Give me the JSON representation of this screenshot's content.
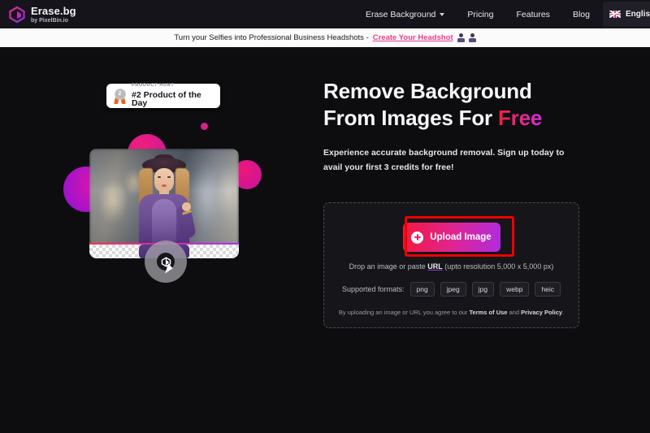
{
  "brand": {
    "name": "Erase.bg",
    "tagline": "by PixelBin.io",
    "logo_icon": "cube-logo-icon"
  },
  "nav": {
    "items": [
      {
        "label": "Erase Background",
        "has_dropdown": true
      },
      {
        "label": "Pricing",
        "has_dropdown": false
      },
      {
        "label": "Features",
        "has_dropdown": false
      },
      {
        "label": "Blog",
        "has_dropdown": false
      }
    ],
    "language": {
      "label": "English",
      "flag_icon": "uk-flag-icon"
    }
  },
  "promo": {
    "text": "Turn your Selfies into Professional Business Headshots -",
    "link": "Create Your Headshot"
  },
  "badge": {
    "kicker": "PRODUCT HUNT",
    "title": "#2 Product of the Day",
    "medal_number": "2",
    "medal_icon": "medal-icon"
  },
  "hero": {
    "title_line1": "Remove Background",
    "title_line2_prefix": "From Images For ",
    "title_highlight": "Free",
    "subtitle": "Experience accurate background removal. Sign up today to avail your first 3 credits for free!"
  },
  "upload": {
    "button_label": "Upload Image",
    "button_icon": "plus-circle-icon",
    "drop_prefix": "Drop an image or paste ",
    "drop_link": "URL",
    "drop_suffix": " (upto resolution 5,000 x 5,000 px)",
    "formats_label": "Supported formats:",
    "formats": [
      "png",
      "jpeg",
      "jpg",
      "webp",
      "heic"
    ],
    "legal_prefix": "By uploading an image or URL you agree to our ",
    "legal_terms": "Terms of Use",
    "legal_and": " and ",
    "legal_privacy": "Privacy Policy",
    "legal_end": "."
  },
  "colors": {
    "page_bg": "#0d0d0f",
    "nav_bg": "#15141a",
    "promo_bg": "#fbfbfb",
    "promo_link": "#e83e8c",
    "accent_red": "#f11a3e",
    "accent_pink": "#e1248c",
    "accent_purple": "#b02ce0",
    "highlight_box": "#ef0000"
  }
}
